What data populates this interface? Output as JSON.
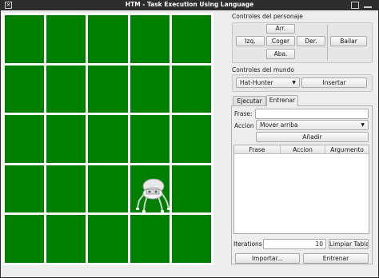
{
  "window": {
    "title": "HTM - Task Execution Using Language"
  },
  "board": {
    "rows": 5,
    "cols": 5,
    "cell_color": "#008000",
    "grid_color": "#ffffff",
    "robot_icon": "robot-icon"
  },
  "character_controls": {
    "group_label": "Controles del personaje",
    "up": "Arr.",
    "left": "Izq.",
    "grab": "Coger",
    "right": "Der.",
    "down": "Aba.",
    "dance": "Bailar"
  },
  "world_controls": {
    "group_label": "Controles del mundo",
    "object_select": "Hat-Hunter",
    "insert": "Insertar"
  },
  "tabs": [
    {
      "label": "Ejecutar",
      "active": false
    },
    {
      "label": "Entrenar",
      "active": true
    }
  ],
  "train": {
    "phrase_label": "Frase:",
    "phrase_value": "",
    "action_label": "Accion",
    "action_select": "Mover arriba",
    "add_button": "Añadir",
    "table_headers": [
      "Frase",
      "Accion",
      "Argumento"
    ],
    "rows": [],
    "iterations_label": "Iterations",
    "iterations_value": "10",
    "clear_button": "Limpiar Tabla",
    "import_button": "Importar...",
    "train_button": "Entrenar"
  }
}
